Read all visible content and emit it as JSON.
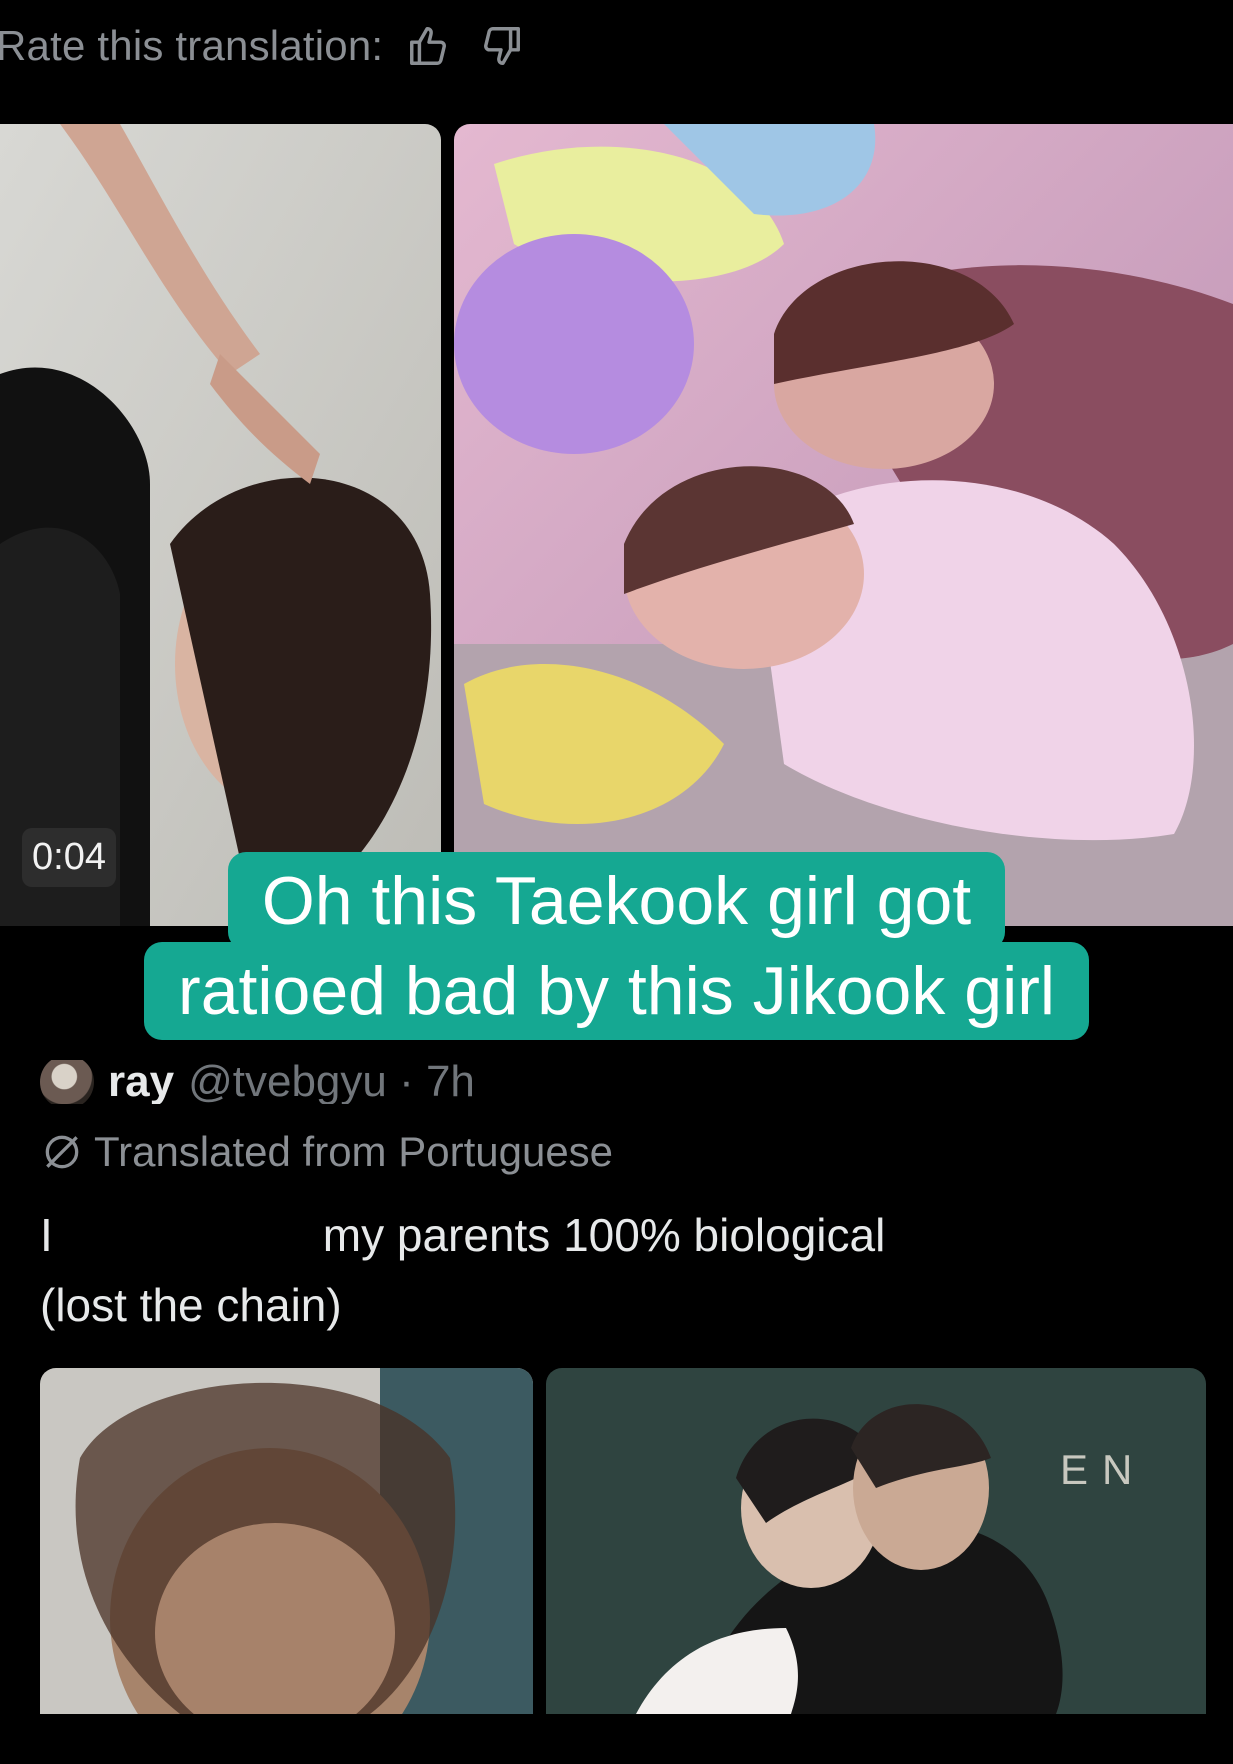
{
  "translation_rating": {
    "label": "Rate this translation:",
    "thumbs_up_icon": "thumbs-up-icon",
    "thumbs_down_icon": "thumbs-down-icon"
  },
  "first_tweet": {
    "media": [
      {
        "type": "video",
        "icon": "video-thumbnail",
        "duration": "0:04"
      },
      {
        "type": "image",
        "icon": "photo"
      }
    ]
  },
  "caption_overlay": {
    "line1": "Oh this Taekook girl got",
    "line2": "ratioed bad by this Jikook girl",
    "background_color": "#15a892"
  },
  "second_tweet": {
    "author_name": "ray",
    "author_handle": "@tvebgyu · 7h",
    "translated_note": "Translated from Portuguese",
    "text_line1_start": "I",
    "text_line1_end": "my parents 100% biological",
    "text_line2": "(lost the chain)",
    "media": [
      {
        "type": "image",
        "icon": "photo"
      },
      {
        "type": "image",
        "icon": "photo",
        "visible_text": "EN"
      }
    ]
  }
}
